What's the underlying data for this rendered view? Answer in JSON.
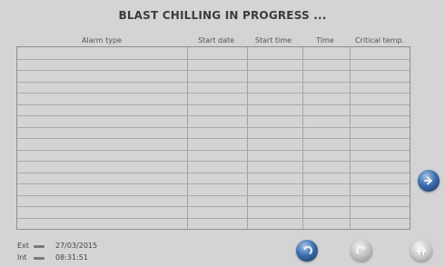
{
  "header": {
    "title": "BLAST CHILLING IN PROGRESS ..."
  },
  "table": {
    "columns": [
      "Alarm type",
      "Start date",
      "Start time",
      "Time",
      "Critical temp."
    ],
    "rows": []
  },
  "footer": {
    "ext_label": "Ext",
    "int_label": "Int",
    "date": "27/03/2015",
    "time": "08:31:51"
  },
  "buttons": {
    "next": {
      "icon": "arrow-right-icon"
    },
    "back": {
      "icon": "undo-arrow-icon"
    },
    "forward": {
      "icon": "redo-arrow-icon"
    },
    "home": {
      "icon": "home-icon"
    }
  },
  "colors": {
    "background": "#d4d4d4",
    "accent_blue": "#3d6fb0",
    "grid_line": "#a9a9a9"
  }
}
